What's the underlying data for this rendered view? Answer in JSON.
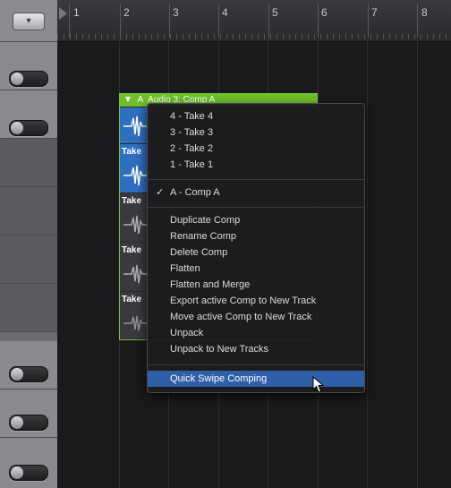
{
  "ruler": {
    "bars": [
      "1",
      "2",
      "3",
      "4",
      "5",
      "6",
      "7",
      "8"
    ]
  },
  "region": {
    "title": "Audio 3: Comp A",
    "take_label": "Take"
  },
  "menu": {
    "takes": [
      "4 - Take 4",
      "3 - Take 3",
      "2 - Take 2",
      "1 - Take 1"
    ],
    "comp": "A - Comp A",
    "actions": [
      "Duplicate Comp",
      "Rename Comp",
      "Delete Comp",
      "Flatten",
      "Flatten and Merge",
      "Export active Comp to New Track",
      "Move active Comp to New Track",
      "Unpack",
      "Unpack to New Tracks"
    ],
    "quick_swipe": "Quick Swipe Comping"
  },
  "colors": {
    "region_green": "#6fc12b",
    "take_blue": "#2e6fc0",
    "menu_highlight": "#2f5fa8"
  }
}
